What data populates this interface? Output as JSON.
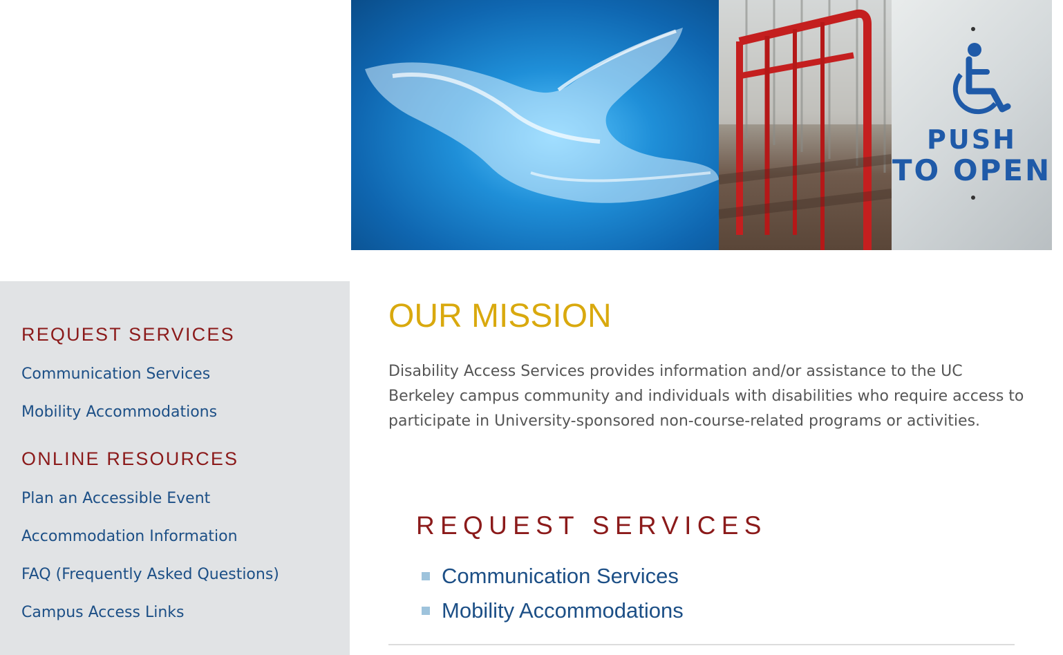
{
  "hero": {
    "door_sign_line1": "PUSH",
    "door_sign_line2": "TO OPEN",
    "panels": [
      "blue-hand-photo",
      "red-railing-photo",
      "push-to-open-door-photo"
    ]
  },
  "sidebar": {
    "sections": [
      {
        "heading": "REQUEST SERVICES",
        "links": [
          "Communication Services",
          "Mobility Accommodations"
        ]
      },
      {
        "heading": "ONLINE RESOURCES",
        "links": [
          "Plan an Accessible Event",
          "Accommodation Information",
          "FAQ (Frequently Asked Questions)",
          "Campus Access Links"
        ]
      }
    ]
  },
  "main": {
    "title": "OUR MISSION",
    "mission_text": "Disability Access Services provides information and/or assistance to the UC Berkeley campus community and individuals with disabilities who require access to participate in University-sponsored non-course-related programs or activities.",
    "request_heading": "REQUEST SERVICES",
    "request_links": [
      "Communication Services",
      "Mobility Accommodations"
    ]
  },
  "colors": {
    "sidebar_bg": "#e1e3e5",
    "heading_red": "#8b1a1a",
    "link_blue": "#1c4f86",
    "title_gold": "#d9a90e",
    "body_gray": "#555555",
    "bullet_blue": "#9ec3dc"
  }
}
